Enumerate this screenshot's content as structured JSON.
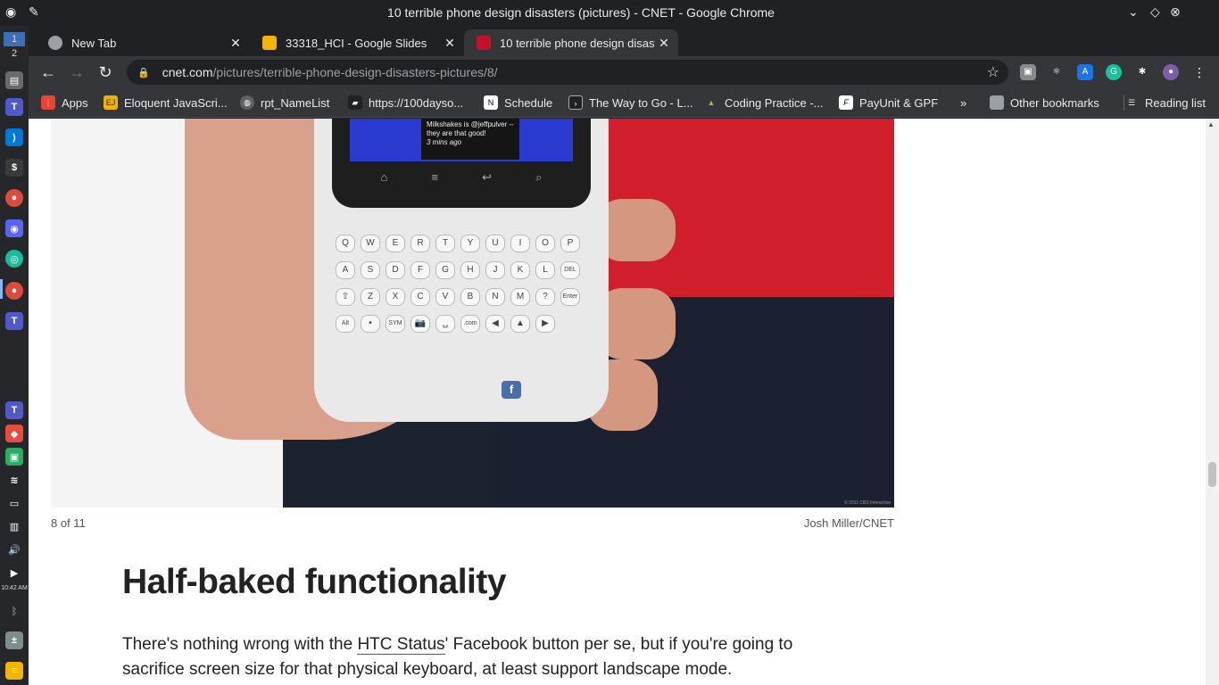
{
  "window": {
    "title": "10 terrible phone design disasters (pictures) - CNET - Google Chrome"
  },
  "dock": {
    "workspace_top": "1",
    "workspace_bottom": "2",
    "clock": "10:42 AM"
  },
  "tabs": [
    {
      "label": "New Tab",
      "favicon_color": "#9aa0a6",
      "active": false
    },
    {
      "label": "33318_HCI - Google Slides",
      "favicon_color": "#f4b400",
      "active": false
    },
    {
      "label": "10 terrible phone design disasters (pictures) - CNET",
      "favicon_color": "#c4102a",
      "active": true
    }
  ],
  "toolbar": {
    "url_host": "cnet.com",
    "url_path": "/pictures/terrible-phone-design-disasters-pictures/8/"
  },
  "bookmarks": {
    "items": [
      {
        "label": "Apps",
        "icon": "apps-grid-icon",
        "color": "#ea4335"
      },
      {
        "label": "Eloquent JavaScri...",
        "icon": "ejs-icon",
        "color": "#f0b400"
      },
      {
        "label": "rpt_NameList",
        "icon": "globe-icon",
        "color": "#5f6368"
      },
      {
        "label": "https://100dayso...",
        "icon": "book-icon",
        "color": "#202124"
      },
      {
        "label": "Schedule",
        "icon": "notion-icon",
        "color": "#202124"
      },
      {
        "label": "The Way to Go - L...",
        "icon": "terminal-icon",
        "color": "#202124"
      },
      {
        "label": "Coding Practice -...",
        "icon": "mountain-icon",
        "color": "#2e7d32"
      },
      {
        "label": "PayUnit & GPF",
        "icon": "f-icon",
        "color": "#202124"
      }
    ],
    "more": "»",
    "other": "Other bookmarks",
    "reading_list": "Reading list"
  },
  "page": {
    "photo": {
      "screen_text": "Milkshakes is @jeffpulver -- they are that good!",
      "screen_time": "3 mins ago",
      "copyright": "© 2011 CBS Interactive",
      "keyboard_rows": [
        [
          "Q",
          "W",
          "E",
          "R",
          "T",
          "Y",
          "U",
          "I",
          "O",
          "P"
        ],
        [
          "A",
          "S",
          "D",
          "F",
          "G",
          "H",
          "J",
          "K",
          "L",
          "DEL"
        ],
        [
          "⇧",
          "Z",
          "X",
          "C",
          "V",
          "B",
          "N",
          "M",
          "?",
          "Enter"
        ],
        [
          "Alt",
          "•",
          "SYM",
          "📷",
          "␣",
          ".com",
          "◀",
          "▲",
          "▶"
        ]
      ],
      "fb_key": "f"
    },
    "gallery_counter": "8 of 11",
    "photo_credit": "Josh Miller/CNET",
    "headline": "Half-baked functionality",
    "body_before_link": "There's nothing wrong with the ",
    "body_link": "HTC Status",
    "body_after_link": "' Facebook button per se, but if you're going to sacrifice screen size for that physical keyboard, at least support landscape mode."
  }
}
